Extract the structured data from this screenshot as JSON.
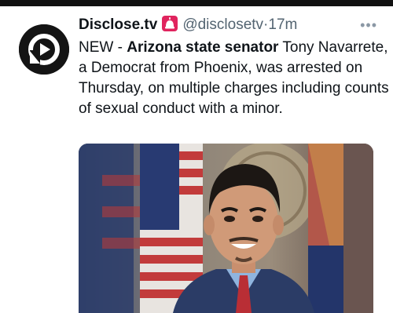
{
  "tweet": {
    "author_name": "Disclose.tv",
    "badge_icon": "siren-icon",
    "handle": "@disclosetv",
    "separator": "·",
    "timestamp": "17m",
    "more_icon": "more-horizontal-icon",
    "more_label": "•••",
    "text": {
      "prefix": "NEW - ",
      "bold": "Arizona state senator",
      "rest": " Tony Navarrete, a Democrat from Phoenix, was arrested on Thursday, on multiple charges including counts of sexual conduct with a minor."
    },
    "media": {
      "icon": "portrait-photo-icon"
    }
  },
  "colors": {
    "text": "#0f1419",
    "secondary": "#536471",
    "avatar_bg": "#141414",
    "siren_red": "#e0245e"
  }
}
